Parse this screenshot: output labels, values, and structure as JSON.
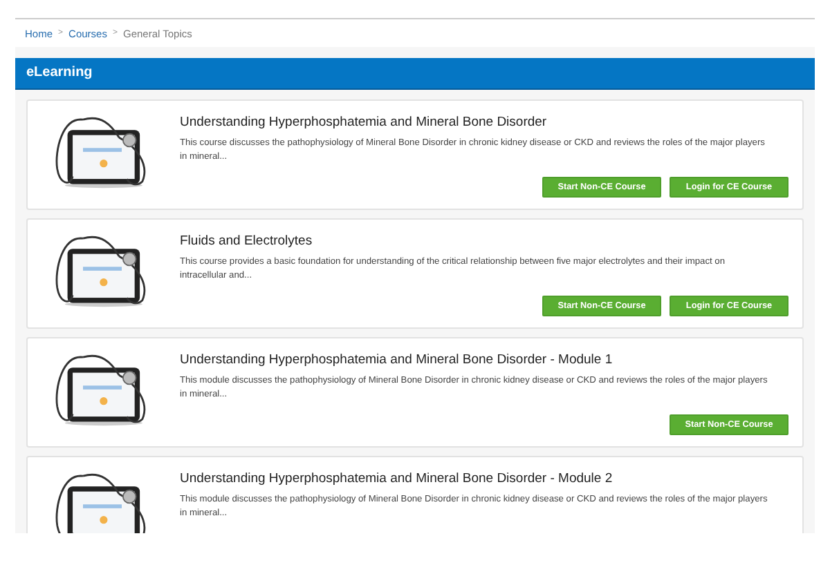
{
  "breadcrumb": [
    {
      "label": "Home",
      "link": true
    },
    {
      "label": "Courses",
      "link": true
    },
    {
      "label": "General Topics",
      "link": false
    }
  ],
  "separator": ">",
  "section": {
    "title": "eLearning"
  },
  "courses": [
    {
      "title": "Understanding Hyperphosphatemia and Mineral Bone Disorder",
      "description": "This course discusses the pathophysiology of Mineral Bone Disorder in chronic kidney disease or CKD and reviews the roles of the major players in mineral...",
      "buttons": [
        "Start Non-CE Course",
        "Login for CE Course"
      ]
    },
    {
      "title": "Fluids and Electrolytes",
      "description": "This course provides a basic foundation for understanding of the critical relationship between five major electrolytes and their impact on intracellular and...",
      "buttons": [
        "Start Non-CE Course",
        "Login for CE Course"
      ]
    },
    {
      "title": "Understanding Hyperphosphatemia and Mineral Bone Disorder - Module 1",
      "description": "This module discusses the pathophysiology of Mineral Bone Disorder in chronic kidney disease or CKD and reviews the roles of the major players in mineral...",
      "buttons": [
        "Start Non-CE Course"
      ]
    },
    {
      "title": "Understanding Hyperphosphatemia and Mineral Bone Disorder - Module 2",
      "description": "This module discusses the pathophysiology of Mineral Bone Disorder in chronic kidney disease or CKD and reviews the roles of the major players in mineral..."
    }
  ]
}
